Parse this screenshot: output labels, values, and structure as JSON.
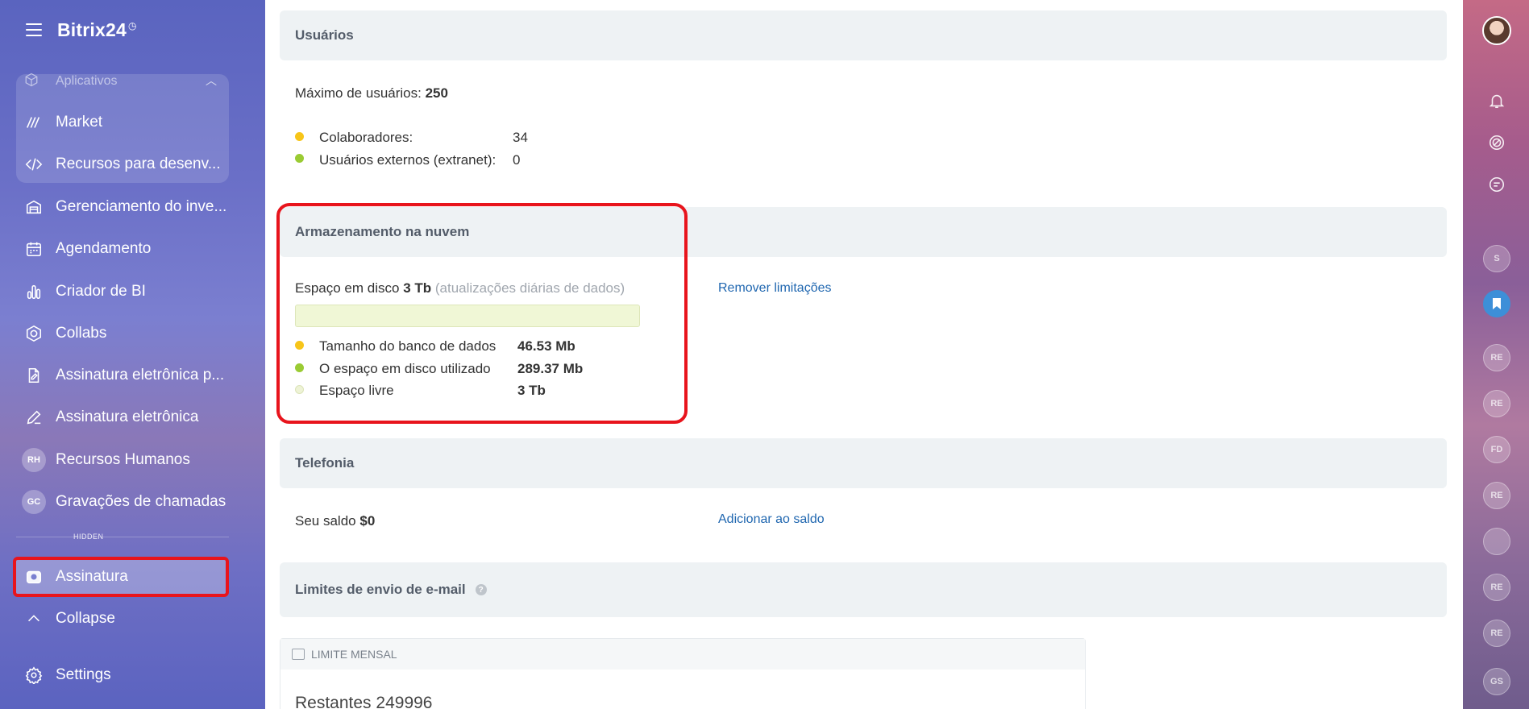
{
  "sidebar": {
    "brand": "Bitrix24",
    "brand_mark": "◷",
    "apps_group_label": "Aplicativos",
    "items": [
      {
        "label": "Market",
        "icon": "market-icon"
      },
      {
        "label": "Recursos para desenv...",
        "icon": "code-icon"
      },
      {
        "label": "Gerenciamento do inve...",
        "icon": "warehouse-icon"
      },
      {
        "label": "Agendamento",
        "icon": "calendar-icon"
      },
      {
        "label": "Criador de BI",
        "icon": "bar-chart-icon"
      },
      {
        "label": "Collabs",
        "icon": "collabs-icon"
      },
      {
        "label": "Assinatura eletrônica p...",
        "icon": "document-sign-icon"
      },
      {
        "label": "Assinatura eletrônica",
        "icon": "pen-icon"
      },
      {
        "label": "Recursos Humanos",
        "badge": "RH"
      },
      {
        "label": "Gravações de chamadas",
        "badge": "GC"
      }
    ],
    "hidden_label": "HIDDEN",
    "active_item": "Assinatura",
    "collapse_label": "Collapse",
    "settings_label": "Settings"
  },
  "users": {
    "title": "Usuários",
    "max_label": "Máximo de usuários:",
    "max_value": "250",
    "collaborators_label": "Colaboradores:",
    "collaborators_value": "34",
    "external_label": "Usuários externos (extranet):",
    "external_value": "0"
  },
  "storage": {
    "title": "Armazenamento na nuvem",
    "disk_label": "Espaço em disco",
    "disk_value": "3 Tb",
    "disk_note": "(atualizações diárias de dados)",
    "remove_limits": "Remover limitações",
    "used_fraction": 0.0001,
    "rows": [
      {
        "label": "Tamanho do banco de dados",
        "value": "46.53 Mb"
      },
      {
        "label": "O espaço em disco utilizado",
        "value": "289.37 Mb"
      },
      {
        "label": "Espaço livre",
        "value": "3 Tb"
      }
    ]
  },
  "telephony": {
    "title": "Telefonia",
    "balance_label": "Seu saldo",
    "balance_value": "$0",
    "add_balance": "Adicionar ao saldo"
  },
  "email": {
    "title": "Limites de envio de e-mail",
    "monthly_label": "LIMITE MENSAL",
    "remaining_label": "Restantes",
    "remaining_value": "249996"
  },
  "rail": {
    "circles": [
      "S",
      "",
      "RE",
      "RE",
      "FD",
      "RE",
      "",
      "RE",
      "RE",
      "GS"
    ]
  },
  "colors": {
    "accent_red": "#e8141c",
    "link_blue": "#2067b0",
    "dot_yellow": "#f7c519",
    "dot_green": "#9acb33"
  }
}
